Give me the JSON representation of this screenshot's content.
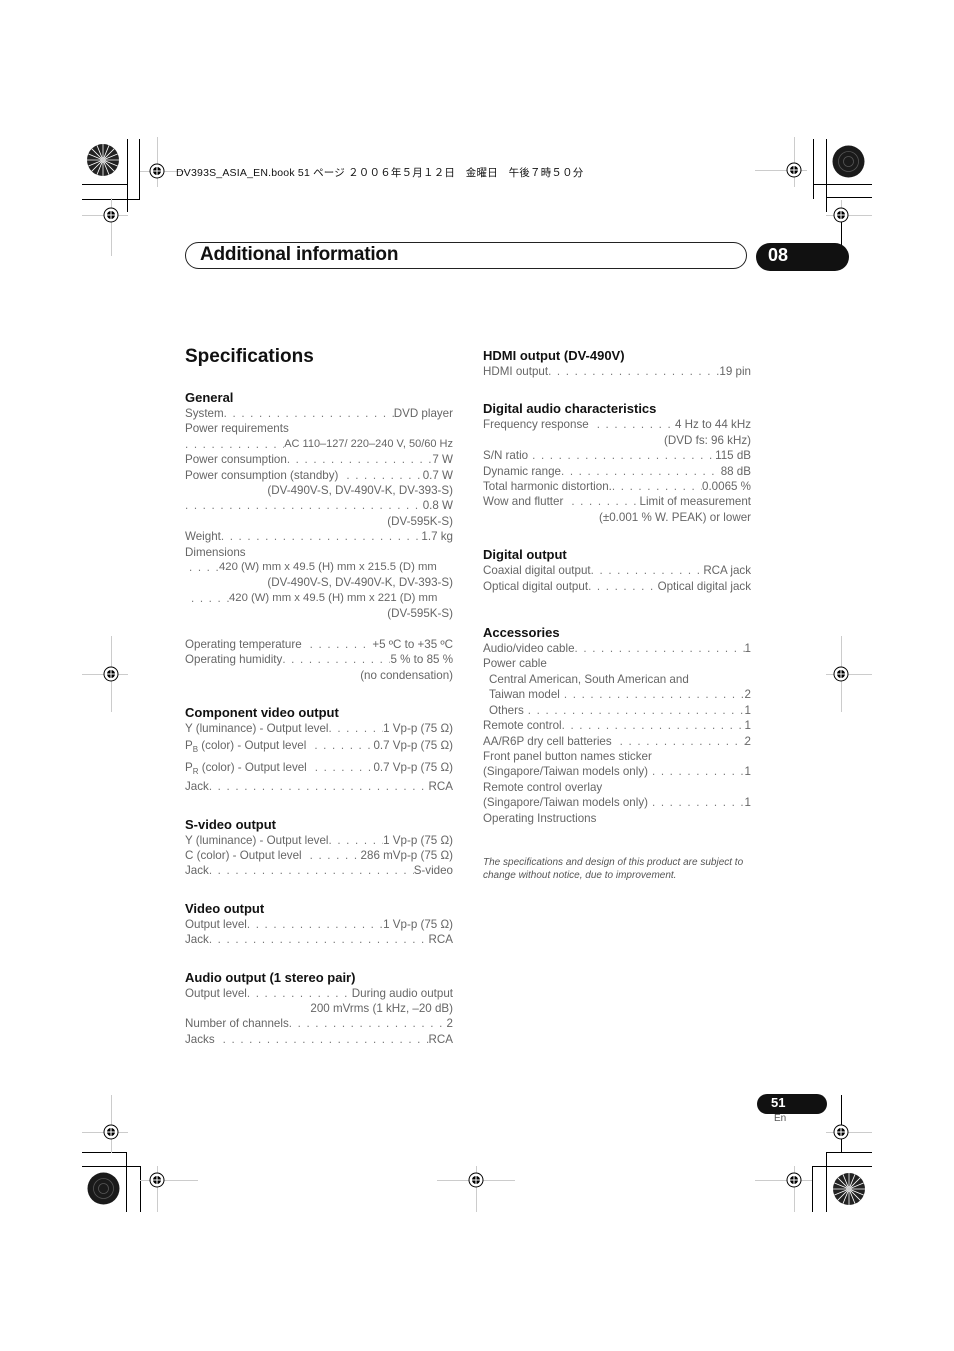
{
  "print_header": {
    "file_info": "DV393S_ASIA_EN.book  51 ページ  ２００６年５月１２日　金曜日　午後７時５０分"
  },
  "section": {
    "title": "Additional information",
    "chapter": "08"
  },
  "page_title": "Specifications",
  "left_column": {
    "general": {
      "heading": "General",
      "system_label": "System",
      "system_value": "DVD player",
      "power_req_label": "Power requirements",
      "power_req_value": "AC 110–127/ 220–240 V, 50/60 Hz",
      "power_cons_label": "Power consumption",
      "power_cons_value": "7 W",
      "standby_label": "Power consumption (standby)",
      "standby_value": "0.7 W",
      "standby_models_1": "(DV-490V-S, DV-490V-K, DV-393-S)",
      "standby_value_2": "0.8 W",
      "standby_models_2": "(DV-595K-S)",
      "weight_label": "Weight",
      "weight_value": "1.7 kg",
      "dimensions_label": "Dimensions",
      "dimensions_value_1": "420 (W) mm x 49.5 (H) mm x 215.5 (D) mm",
      "dimensions_models_1": "(DV-490V-S, DV-490V-K, DV-393-S)",
      "dimensions_value_2": "420 (W) mm x 49.5 (H) mm x 221 (D) mm",
      "dimensions_models_2": "(DV-595K-S)",
      "temp_label": "Operating temperature",
      "temp_value": "+5 ºC to +35 ºC",
      "humidity_label": "Operating humidity",
      "humidity_value": "5 % to 85 %",
      "humidity_note": "(no condensation)"
    },
    "component_video": {
      "heading": "Component video output",
      "y_label": "Y (luminance) - Output level",
      "y_value": "1 Vp-p (75 Ω)",
      "pb_main": "P",
      "pb_sub": "B",
      "pb_label": " (color) - Output level",
      "pb_value": "0.7 Vp-p (75 Ω)",
      "pr_main": "P",
      "pr_sub": "R",
      "pr_label": " (color) - Output level",
      "pr_value": "0.7 Vp-p (75 Ω)",
      "jack_label": "Jack",
      "jack_value": "RCA"
    },
    "svideo": {
      "heading": "S-video output",
      "y_label": "Y (luminance) - Output level",
      "y_value": "1 Vp-p (75 Ω)",
      "c_label": "C (color) - Output level",
      "c_value": "286 mVp-p (75 Ω)",
      "jack_label": "Jack",
      "jack_value": "S-video"
    },
    "video": {
      "heading": "Video output",
      "level_label": "Output level",
      "level_value": "1 Vp-p (75 Ω)",
      "jack_label": "Jack",
      "jack_value": "RCA"
    },
    "audio": {
      "heading": "Audio output (1 stereo pair)",
      "level_label": "Output level",
      "level_value": "During audio output",
      "level_value_2": "200 mVrms (1 kHz, –20 dB)",
      "channels_label": "Number of channels",
      "channels_value": "2",
      "jacks_label": "Jacks",
      "jacks_value": "RCA"
    }
  },
  "right_column": {
    "hdmi": {
      "heading": "HDMI output (DV-490V)",
      "label": "HDMI output",
      "value": "19 pin"
    },
    "digital_audio": {
      "heading": "Digital audio characteristics",
      "freq_label": "Frequency response",
      "freq_value": "4 Hz to 44 kHz",
      "freq_note": "(DVD fs: 96 kHz)",
      "sn_label": "S/N ratio",
      "sn_value": "115 dB",
      "dyn_label": "Dynamic range",
      "dyn_value": "88 dB",
      "thd_label": "Total harmonic distortion.",
      "thd_value": "0.0065 %",
      "wow_label": "Wow and flutter",
      "wow_value": "Limit of measurement",
      "wow_note": "(±0.001 % W. PEAK) or lower"
    },
    "digital_output": {
      "heading": "Digital output",
      "coax_label": "Coaxial digital output",
      "coax_value": "RCA jack",
      "optical_label": "Optical digital output",
      "optical_value": "Optical digital jack"
    },
    "accessories": {
      "heading": "Accessories",
      "av_cable_label": "Audio/video cable",
      "av_cable_value": "1",
      "power_cable_label": "Power cable",
      "central_label": "Central American, South American and",
      "taiwan_label": "Taiwan model",
      "taiwan_value": "2",
      "others_label": "Others",
      "others_value": "1",
      "remote_label": "Remote control",
      "remote_value": "1",
      "batteries_label": "AA/R6P dry cell batteries",
      "batteries_value": "2",
      "sticker_label": "Front panel button names sticker",
      "sticker_models_label": "(Singapore/Taiwan models only)",
      "sticker_value": "1",
      "overlay_label": "Remote control overlay",
      "overlay_models_label": "(Singapore/Taiwan models only)",
      "overlay_value": "1",
      "instructions_label": "Operating Instructions"
    },
    "note": "The specifications and design of this product are subject to change without notice, due to improvement."
  },
  "footer": {
    "page_number": "51",
    "language": "En"
  }
}
